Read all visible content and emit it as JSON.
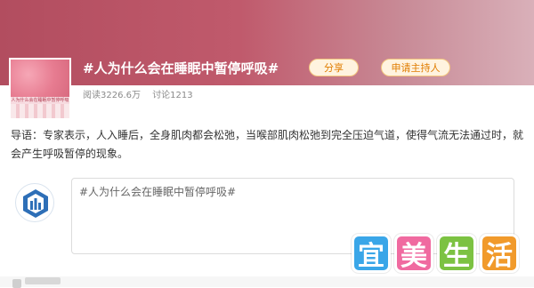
{
  "topic": {
    "title": "#人为什么会在睡眠中暂停呼吸#",
    "share_label": "分享",
    "host_label": "申请主持人",
    "reads": "阅读3226.6万",
    "discussions": "讨论1213",
    "thumbnail_caption": "人为什么会在睡眠中暂停呼吸"
  },
  "intro": "导语：专家表示，人入睡后，全身肌肉都会松弛，当喉部肌肉松弛到完全压迫气道，使得气流无法通过时，就会产生呼吸暂停的现象。",
  "composer": {
    "placeholder_text": "#人为什么会在睡眠中暂停呼吸#"
  },
  "watermark": {
    "chars": [
      "宜",
      "美",
      "生",
      "活"
    ],
    "colors": [
      "#3aa6e8",
      "#f06aa0",
      "#7cc242",
      "#f19a2b"
    ]
  },
  "colors": {
    "banner_start": "#b24d5f",
    "accent_orange": "#e07d00"
  }
}
